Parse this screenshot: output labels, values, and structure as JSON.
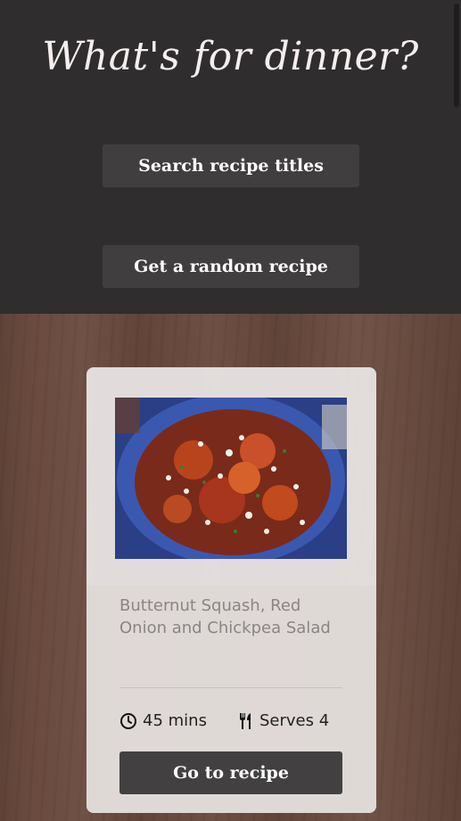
{
  "header": {
    "title": "What's for dinner?",
    "search_button": "Search recipe titles",
    "random_button": "Get a random recipe"
  },
  "card": {
    "recipe_name": "Butternut Squash, Red Onion and Chickpea Salad",
    "time": "45 mins",
    "serves": "Serves 4",
    "go_button": "Go to recipe",
    "photo_icon": "recipe-photo"
  },
  "icons": {
    "clock": "clock-icon",
    "utensils": "utensils-icon"
  }
}
